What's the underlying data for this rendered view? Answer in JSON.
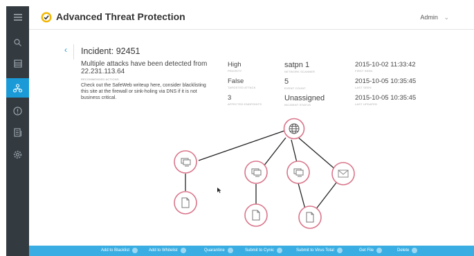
{
  "topbar": {
    "title": "Advanced Threat Protection",
    "user": "Admin",
    "user_chevron": "⌄"
  },
  "sidebar": {
    "items": [
      {
        "icon": "menu-icon",
        "active": false
      },
      {
        "icon": "search-icon",
        "active": false
      },
      {
        "icon": "dashboard-icon",
        "active": false
      },
      {
        "icon": "incidents-icon",
        "active": true
      },
      {
        "icon": "alert-icon",
        "active": false
      },
      {
        "icon": "reports-icon",
        "active": false
      },
      {
        "icon": "settings-icon",
        "active": false
      }
    ]
  },
  "incident": {
    "back_glyph": "‹",
    "title": "Incident: 92451",
    "summary": "Multiple attacks have been detected from 22.231.113.64",
    "recommended_label": "RECOMMENDED ACTIONS",
    "recommended_text": "Check out the SafeWeb writeup here, consider blacklisting this site at the firewall or sink-holing via DNS if it is not business critical."
  },
  "fields": {
    "priority": {
      "value": "High",
      "label": "PRIORITY"
    },
    "targeted": {
      "value": "False",
      "label": "TARGETED ATTACK"
    },
    "affected": {
      "value": "3",
      "label": "AFFECTED ENDPOINTS"
    },
    "scanner": {
      "value": "satpn 1",
      "label": "NETWORK SCANNER"
    },
    "event_count": {
      "value": "5",
      "label": "EVENT COUNT"
    },
    "status": {
      "value": "Unassigned",
      "label": "INCIDENT STATUS"
    },
    "first_seen": {
      "value": "2015-10-02 11:33:42",
      "label": "FIRST SEEN"
    },
    "last_seen": {
      "value": "2015-10-05 10:35:45",
      "label": "LAST SEEN"
    },
    "last_updated": {
      "value": "2015-10-05 10:35:45",
      "label": "LAST UPDATED"
    }
  },
  "graph": {
    "nodes": [
      "globe-icon",
      "computer-icon",
      "computer-icon",
      "computer-icon",
      "email-icon",
      "file-icon",
      "file-icon",
      "file-icon"
    ],
    "accent": "#d9758a"
  },
  "actions": [
    {
      "label": "Add to Blacklist",
      "icon": "blacklist-icon"
    },
    {
      "label": "Add to Whitelist",
      "icon": "whitelist-icon"
    },
    {
      "label": "Quarantine",
      "icon": "quarantine-icon"
    },
    {
      "label": "Submit to Cynic",
      "icon": "cynic-icon"
    },
    {
      "label": "Submit to Virus Total",
      "icon": "virustotal-icon"
    },
    {
      "label": "Get File",
      "icon": "get-file-icon"
    },
    {
      "label": "Delete",
      "icon": "delete-icon"
    }
  ],
  "colors": {
    "sidebar": "#333a40",
    "accent": "#1a9bd7",
    "actionbar": "#3aaee2",
    "node": "#d9758a"
  }
}
